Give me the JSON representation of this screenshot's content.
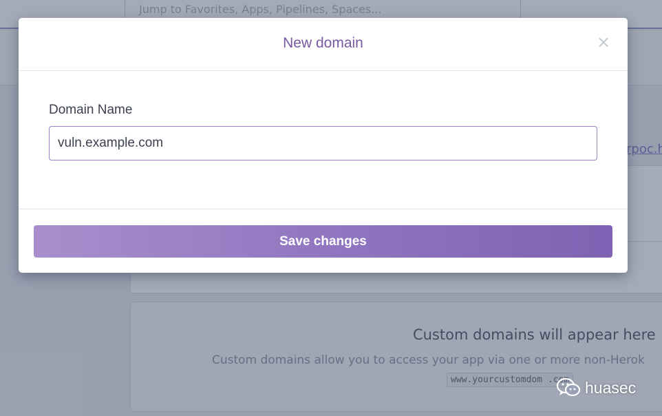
{
  "background": {
    "search_placeholder": "Jump to Favorites, Apps, Pipelines, Spaces...",
    "partial_link": "rpoc.h",
    "empty_state": {
      "title": "Custom domains will appear here",
      "description": "Custom domains allow you to access your app via one or more non-Herok",
      "example_code": "www.yourcustomdom   .com"
    }
  },
  "modal": {
    "title": "New domain",
    "close_symbol": "×",
    "field_label": "Domain Name",
    "domain_value": "vuln.example.com",
    "save_label": "Save changes"
  },
  "watermark": {
    "icon": "wechat-icon",
    "text": "huasec"
  },
  "colors": {
    "accent": "#79589f",
    "button_gradient_start": "#a88fcc",
    "button_gradient_end": "#7f62b3",
    "input_border": "#9b7fc4"
  }
}
